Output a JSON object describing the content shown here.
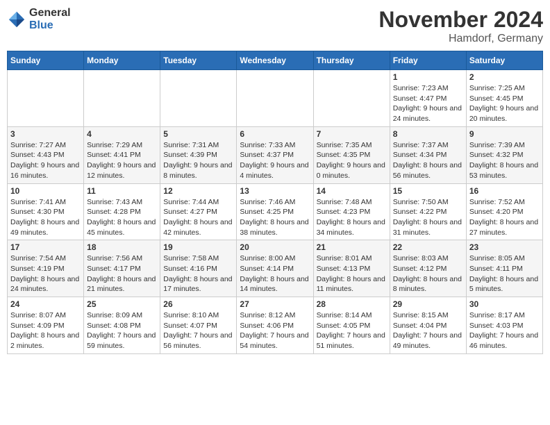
{
  "logo": {
    "general": "General",
    "blue": "Blue"
  },
  "header": {
    "month": "November 2024",
    "location": "Hamdorf, Germany"
  },
  "days_of_week": [
    "Sunday",
    "Monday",
    "Tuesday",
    "Wednesday",
    "Thursday",
    "Friday",
    "Saturday"
  ],
  "weeks": [
    [
      {
        "day": "",
        "info": ""
      },
      {
        "day": "",
        "info": ""
      },
      {
        "day": "",
        "info": ""
      },
      {
        "day": "",
        "info": ""
      },
      {
        "day": "",
        "info": ""
      },
      {
        "day": "1",
        "info": "Sunrise: 7:23 AM\nSunset: 4:47 PM\nDaylight: 9 hours and 24 minutes."
      },
      {
        "day": "2",
        "info": "Sunrise: 7:25 AM\nSunset: 4:45 PM\nDaylight: 9 hours and 20 minutes."
      }
    ],
    [
      {
        "day": "3",
        "info": "Sunrise: 7:27 AM\nSunset: 4:43 PM\nDaylight: 9 hours and 16 minutes."
      },
      {
        "day": "4",
        "info": "Sunrise: 7:29 AM\nSunset: 4:41 PM\nDaylight: 9 hours and 12 minutes."
      },
      {
        "day": "5",
        "info": "Sunrise: 7:31 AM\nSunset: 4:39 PM\nDaylight: 9 hours and 8 minutes."
      },
      {
        "day": "6",
        "info": "Sunrise: 7:33 AM\nSunset: 4:37 PM\nDaylight: 9 hours and 4 minutes."
      },
      {
        "day": "7",
        "info": "Sunrise: 7:35 AM\nSunset: 4:35 PM\nDaylight: 9 hours and 0 minutes."
      },
      {
        "day": "8",
        "info": "Sunrise: 7:37 AM\nSunset: 4:34 PM\nDaylight: 8 hours and 56 minutes."
      },
      {
        "day": "9",
        "info": "Sunrise: 7:39 AM\nSunset: 4:32 PM\nDaylight: 8 hours and 53 minutes."
      }
    ],
    [
      {
        "day": "10",
        "info": "Sunrise: 7:41 AM\nSunset: 4:30 PM\nDaylight: 8 hours and 49 minutes."
      },
      {
        "day": "11",
        "info": "Sunrise: 7:43 AM\nSunset: 4:28 PM\nDaylight: 8 hours and 45 minutes."
      },
      {
        "day": "12",
        "info": "Sunrise: 7:44 AM\nSunset: 4:27 PM\nDaylight: 8 hours and 42 minutes."
      },
      {
        "day": "13",
        "info": "Sunrise: 7:46 AM\nSunset: 4:25 PM\nDaylight: 8 hours and 38 minutes."
      },
      {
        "day": "14",
        "info": "Sunrise: 7:48 AM\nSunset: 4:23 PM\nDaylight: 8 hours and 34 minutes."
      },
      {
        "day": "15",
        "info": "Sunrise: 7:50 AM\nSunset: 4:22 PM\nDaylight: 8 hours and 31 minutes."
      },
      {
        "day": "16",
        "info": "Sunrise: 7:52 AM\nSunset: 4:20 PM\nDaylight: 8 hours and 27 minutes."
      }
    ],
    [
      {
        "day": "17",
        "info": "Sunrise: 7:54 AM\nSunset: 4:19 PM\nDaylight: 8 hours and 24 minutes."
      },
      {
        "day": "18",
        "info": "Sunrise: 7:56 AM\nSunset: 4:17 PM\nDaylight: 8 hours and 21 minutes."
      },
      {
        "day": "19",
        "info": "Sunrise: 7:58 AM\nSunset: 4:16 PM\nDaylight: 8 hours and 17 minutes."
      },
      {
        "day": "20",
        "info": "Sunrise: 8:00 AM\nSunset: 4:14 PM\nDaylight: 8 hours and 14 minutes."
      },
      {
        "day": "21",
        "info": "Sunrise: 8:01 AM\nSunset: 4:13 PM\nDaylight: 8 hours and 11 minutes."
      },
      {
        "day": "22",
        "info": "Sunrise: 8:03 AM\nSunset: 4:12 PM\nDaylight: 8 hours and 8 minutes."
      },
      {
        "day": "23",
        "info": "Sunrise: 8:05 AM\nSunset: 4:11 PM\nDaylight: 8 hours and 5 minutes."
      }
    ],
    [
      {
        "day": "24",
        "info": "Sunrise: 8:07 AM\nSunset: 4:09 PM\nDaylight: 8 hours and 2 minutes."
      },
      {
        "day": "25",
        "info": "Sunrise: 8:09 AM\nSunset: 4:08 PM\nDaylight: 7 hours and 59 minutes."
      },
      {
        "day": "26",
        "info": "Sunrise: 8:10 AM\nSunset: 4:07 PM\nDaylight: 7 hours and 56 minutes."
      },
      {
        "day": "27",
        "info": "Sunrise: 8:12 AM\nSunset: 4:06 PM\nDaylight: 7 hours and 54 minutes."
      },
      {
        "day": "28",
        "info": "Sunrise: 8:14 AM\nSunset: 4:05 PM\nDaylight: 7 hours and 51 minutes."
      },
      {
        "day": "29",
        "info": "Sunrise: 8:15 AM\nSunset: 4:04 PM\nDaylight: 7 hours and 49 minutes."
      },
      {
        "day": "30",
        "info": "Sunrise: 8:17 AM\nSunset: 4:03 PM\nDaylight: 7 hours and 46 minutes."
      }
    ]
  ]
}
